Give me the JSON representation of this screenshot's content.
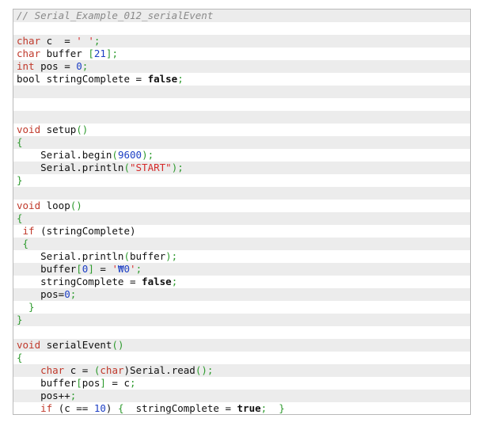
{
  "code": {
    "lines": [
      [
        {
          "t": "// Serial_Example_012_serialEvent",
          "c": "comment"
        }
      ],
      [],
      [
        {
          "t": "char",
          "c": "type"
        },
        {
          "t": " c  = ",
          "c": "plain"
        },
        {
          "t": "' '",
          "c": "str"
        },
        {
          "t": ";",
          "c": "punc"
        }
      ],
      [
        {
          "t": "char",
          "c": "type"
        },
        {
          "t": " buffer ",
          "c": "plain"
        },
        {
          "t": "[",
          "c": "punc"
        },
        {
          "t": "21",
          "c": "num"
        },
        {
          "t": "];",
          "c": "punc"
        }
      ],
      [
        {
          "t": "int",
          "c": "type"
        },
        {
          "t": " pos = ",
          "c": "plain"
        },
        {
          "t": "0",
          "c": "num"
        },
        {
          "t": ";",
          "c": "punc"
        }
      ],
      [
        {
          "t": "bool stringComplete = ",
          "c": "plain"
        },
        {
          "t": "false",
          "c": "bool"
        },
        {
          "t": ";",
          "c": "punc"
        }
      ],
      [],
      [],
      [],
      [
        {
          "t": "void",
          "c": "type"
        },
        {
          "t": " setup",
          "c": "plain"
        },
        {
          "t": "()",
          "c": "punc"
        }
      ],
      [
        {
          "t": "{",
          "c": "punc"
        }
      ],
      [
        {
          "t": "    Serial.begin",
          "c": "plain"
        },
        {
          "t": "(",
          "c": "punc"
        },
        {
          "t": "9600",
          "c": "num"
        },
        {
          "t": ");",
          "c": "punc"
        }
      ],
      [
        {
          "t": "    Serial.println",
          "c": "plain"
        },
        {
          "t": "(",
          "c": "punc"
        },
        {
          "t": "\"START\"",
          "c": "str"
        },
        {
          "t": ");",
          "c": "punc"
        }
      ],
      [
        {
          "t": "}",
          "c": "punc"
        }
      ],
      [],
      [
        {
          "t": "void",
          "c": "type"
        },
        {
          "t": " loop",
          "c": "plain"
        },
        {
          "t": "()",
          "c": "punc"
        }
      ],
      [
        {
          "t": "{",
          "c": "punc"
        }
      ],
      [
        {
          "t": " if",
          "c": "type"
        },
        {
          "t": " (stringComplete)",
          "c": "plain"
        }
      ],
      [
        {
          "t": " {",
          "c": "punc"
        }
      ],
      [
        {
          "t": "    Serial.println",
          "c": "plain"
        },
        {
          "t": "(",
          "c": "punc"
        },
        {
          "t": "buffer",
          "c": "plain"
        },
        {
          "t": ");",
          "c": "punc"
        }
      ],
      [
        {
          "t": "    buffer",
          "c": "plain"
        },
        {
          "t": "[",
          "c": "punc"
        },
        {
          "t": "0",
          "c": "num"
        },
        {
          "t": "]",
          "c": "punc"
        },
        {
          "t": " = ",
          "c": "plain"
        },
        {
          "t": "'",
          "c": "str"
        },
        {
          "t": "₩0",
          "c": "num"
        },
        {
          "t": "'",
          "c": "str"
        },
        {
          "t": ";",
          "c": "punc"
        }
      ],
      [
        {
          "t": "    stringComplete = ",
          "c": "plain"
        },
        {
          "t": "false",
          "c": "bool"
        },
        {
          "t": ";",
          "c": "punc"
        }
      ],
      [
        {
          "t": "    pos=",
          "c": "plain"
        },
        {
          "t": "0",
          "c": "num"
        },
        {
          "t": ";",
          "c": "punc"
        }
      ],
      [
        {
          "t": "  }",
          "c": "punc"
        }
      ],
      [
        {
          "t": "}",
          "c": "punc"
        }
      ],
      [],
      [
        {
          "t": "void",
          "c": "type"
        },
        {
          "t": " serialEvent",
          "c": "plain"
        },
        {
          "t": "()",
          "c": "punc"
        }
      ],
      [
        {
          "t": "{",
          "c": "punc"
        }
      ],
      [
        {
          "t": "    ",
          "c": "plain"
        },
        {
          "t": "char",
          "c": "type"
        },
        {
          "t": " c = ",
          "c": "plain"
        },
        {
          "t": "(",
          "c": "punc"
        },
        {
          "t": "char",
          "c": "type"
        },
        {
          "t": ")Serial.read",
          "c": "plain"
        },
        {
          "t": "();",
          "c": "punc"
        }
      ],
      [
        {
          "t": "    buffer",
          "c": "plain"
        },
        {
          "t": "[",
          "c": "punc"
        },
        {
          "t": "pos",
          "c": "plain"
        },
        {
          "t": "]",
          "c": "punc"
        },
        {
          "t": " = c",
          "c": "plain"
        },
        {
          "t": ";",
          "c": "punc"
        }
      ],
      [
        {
          "t": "    pos++",
          "c": "plain"
        },
        {
          "t": ";",
          "c": "punc"
        }
      ],
      [
        {
          "t": "    ",
          "c": "plain"
        },
        {
          "t": "if",
          "c": "type"
        },
        {
          "t": " (c == ",
          "c": "plain"
        },
        {
          "t": "10",
          "c": "num"
        },
        {
          "t": ") ",
          "c": "plain"
        },
        {
          "t": "{",
          "c": "punc"
        },
        {
          "t": "  stringComplete = ",
          "c": "plain"
        },
        {
          "t": "true",
          "c": "bool"
        },
        {
          "t": ";",
          "c": "punc"
        },
        {
          "t": "  ",
          "c": "plain"
        },
        {
          "t": "}",
          "c": "punc"
        }
      ],
      [
        {
          "t": "}",
          "c": "punc"
        }
      ]
    ]
  }
}
